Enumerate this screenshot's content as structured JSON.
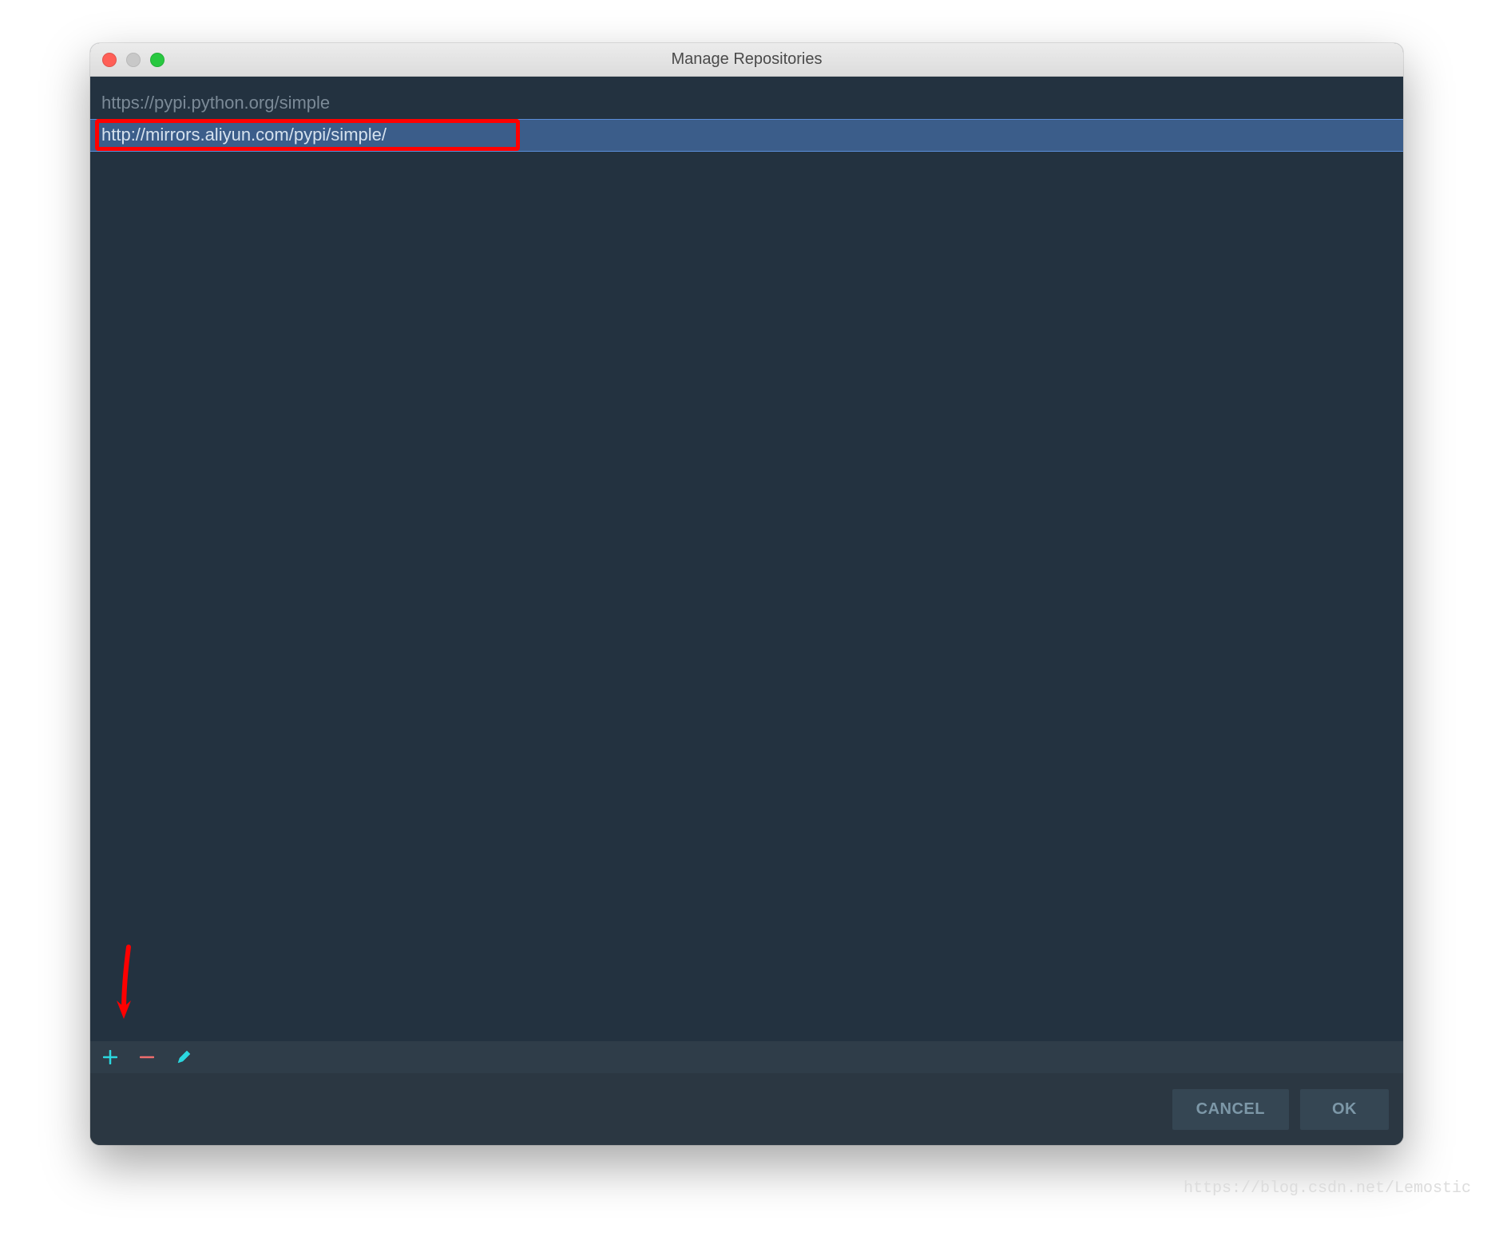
{
  "window": {
    "title": "Manage Repositories"
  },
  "repositories": {
    "items": [
      {
        "url": "https://pypi.python.org/simple",
        "selected": false
      },
      {
        "url": "http://mirrors.aliyun.com/pypi/simple/",
        "selected": true
      }
    ]
  },
  "toolbar": {
    "add_icon": "plus-icon",
    "remove_icon": "minus-icon",
    "edit_icon": "pencil-icon"
  },
  "buttons": {
    "cancel": "CANCEL",
    "ok": "OK"
  },
  "annotations": {
    "highlight_color": "#ff0000",
    "arrow_color": "#ff0000"
  },
  "watermark": "https://blog.csdn.net/Lemostic",
  "colors": {
    "window_bg": "#2b3742",
    "content_bg": "#233240",
    "toolbar_bg": "#2f3d49",
    "selected_bg": "#3b5d8a",
    "accent": "#2bd7df",
    "remove_accent": "#ee6d6d"
  }
}
